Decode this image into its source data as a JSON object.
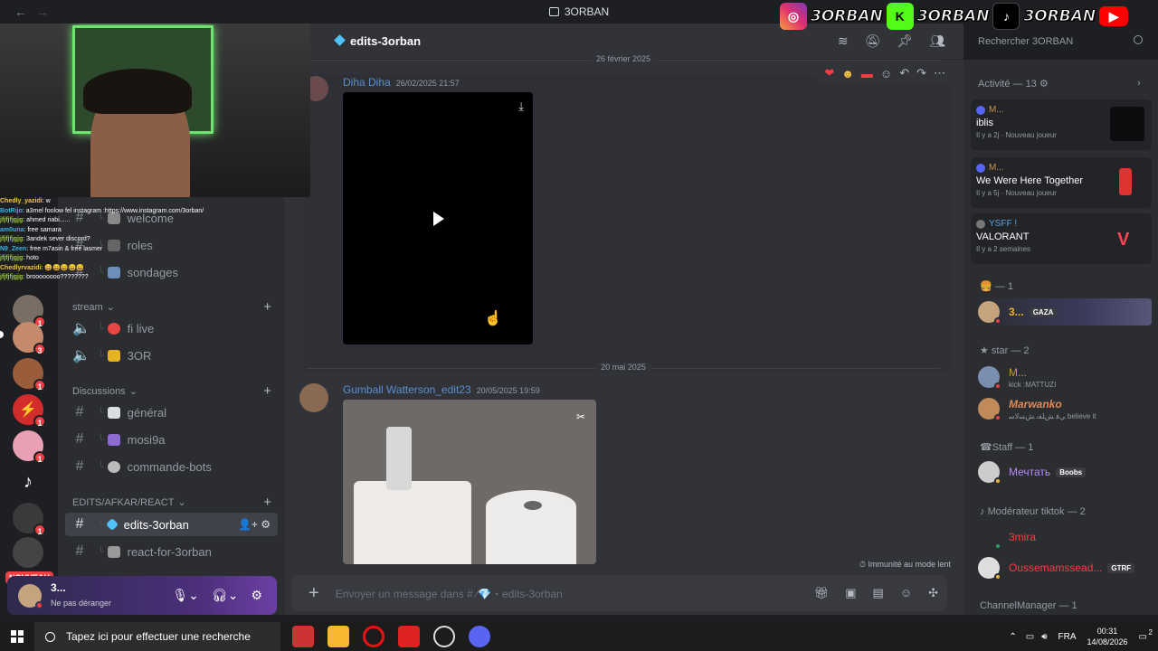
{
  "titlebar": {
    "app_title": "3ORBAN",
    "back": "←",
    "forward": "→"
  },
  "socials": {
    "instagram": "3ORBAN",
    "kick": "3ORBAN",
    "tiktok": "3ORBAN"
  },
  "stream_chat": [
    {
      "user": "Chedly_yazidi",
      "text": ": w"
    },
    {
      "user": "BotRijo",
      "text": ": a3mel foolow fel instagram :https://www.instagram.com/3orban/"
    },
    {
      "user": "jfjfjfjgjg",
      "text": ": ahmed riabi......"
    },
    {
      "user": "am0una",
      "text": ": free samara"
    },
    {
      "user": "jfjfjfjgjg",
      "text": ": 3andek sever discord?"
    },
    {
      "user": "N9_Zeen",
      "text": ": free m7asin & free lasmer"
    },
    {
      "user": "jfjfjfjgjg",
      "text": ": hoto"
    },
    {
      "user": "Chedlyrvazidi",
      "text": ": 😄😄😄😄😄"
    },
    {
      "user": "jfjfjfjgjg",
      "text": ": broooooooo????????"
    }
  ],
  "servers": {
    "badges": [
      "1",
      "3",
      "1",
      "1",
      "1",
      "1"
    ],
    "nouveau": "NOUVEAU"
  },
  "sidebar": {
    "channels_top": [
      {
        "name": "welcome"
      },
      {
        "name": "roles"
      },
      {
        "name": "sondages"
      }
    ],
    "cat_stream": "stream",
    "stream": [
      {
        "name": "fi live"
      },
      {
        "name": "3OR"
      }
    ],
    "cat_discussions": "Discussions",
    "discussions": [
      {
        "name": "général"
      },
      {
        "name": "mosi9a"
      },
      {
        "name": "commande-bots"
      }
    ],
    "cat_edits": "EDITS/AFKAR/REACT",
    "edits": [
      {
        "name": "edits-3orban"
      },
      {
        "name": "react-for-3orban"
      }
    ]
  },
  "userpanel": {
    "name": "3...",
    "status": "Ne pas déranger"
  },
  "channel_header": {
    "name": "edits-3orban",
    "search_placeholder": "Rechercher 3ORBAN"
  },
  "messages": {
    "date1": "26 février 2025",
    "m1_author": "Diha Diha",
    "m1_time": "26/02/2025 21:57",
    "date2": "20 mai 2025",
    "m2_author": "Gumball Watterson_edit23",
    "m2_time": "20/05/2025 19:59"
  },
  "composer": {
    "placeholder": "Envoyer un message dans # ⁄💎・edits-3orban",
    "slowmode": "Immunité au mode lent"
  },
  "activity": {
    "header": "Activité — 13",
    "cards": [
      {
        "user": "M...",
        "game": "iblis",
        "time": "Il y a 2j",
        "tag": "Nouveau joueur"
      },
      {
        "user": "M...",
        "game": "We Were Here Together",
        "time": "Il y a 5j",
        "tag": "Nouveau joueur"
      },
      {
        "user": "YSFF !",
        "game": "VALORANT",
        "time": "Il y a 2 semaines",
        "tag": ""
      }
    ]
  },
  "members": {
    "role1": "— 1",
    "m1_name": "3...",
    "m1_tag": "GAZA",
    "role2": "star — 2",
    "m2_name": "M...",
    "m2_status": "kick :MATTUZI",
    "m3_name": "Marwanko",
    "m3_status": "ﻲﻓ ﺶﻠﻔﻧ ﺶﺴﻟﺎﺳ believe it",
    "role3": "Staff — 1",
    "m4_name": "Мечтать",
    "m4_tag": "Boobs",
    "role4": "Modérateur tiktok — 2",
    "m5_name": "3mira",
    "m6_name": "Oussemamssead...",
    "m6_tag": "GTRF",
    "role5": "ChannelManager — 1"
  },
  "taskbar": {
    "search": "Tapez ici pour effectuer une recherche",
    "lang": "FRA",
    "time": "00:31",
    "date": "14/08/2026",
    "notif": "2"
  },
  "colors": {
    "accent": "#5865f2",
    "dnd": "#f23f43",
    "online": "#23a55a",
    "link": "#5a8fcf"
  }
}
